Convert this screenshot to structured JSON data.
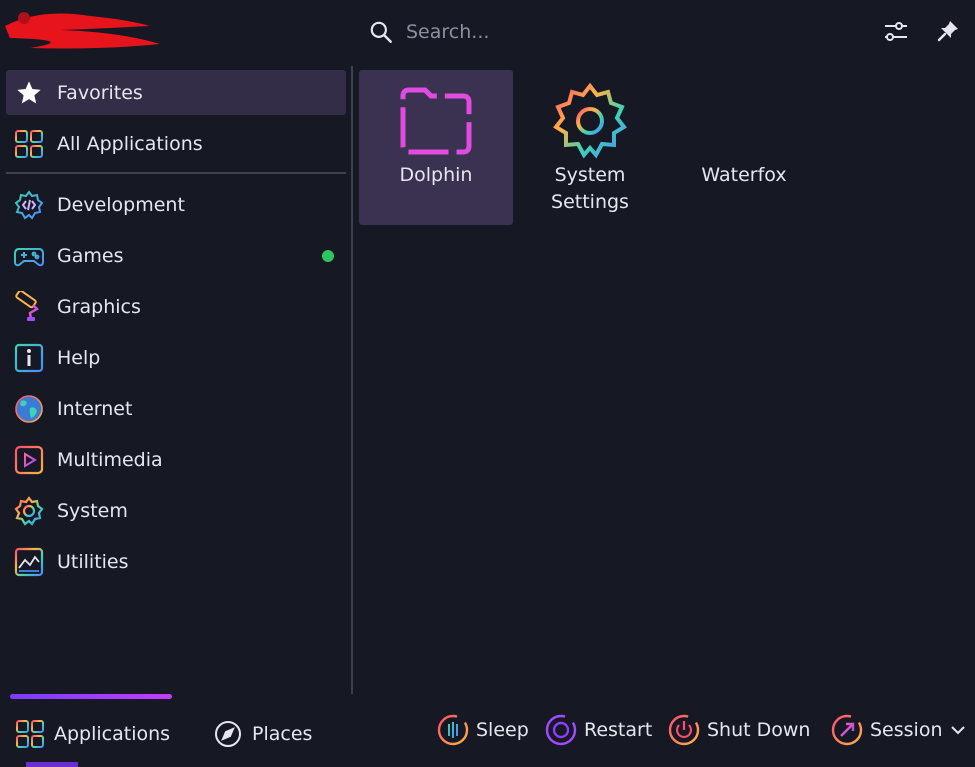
{
  "header": {
    "search_placeholder": "Search...",
    "icons": [
      "search-icon",
      "filter-settings-icon",
      "pin-icon"
    ]
  },
  "sidebar": {
    "items": [
      {
        "label": "Favorites",
        "icon": "star-icon",
        "active": true
      },
      {
        "label": "All Applications",
        "icon": "grid-icon"
      },
      {
        "label": "Development",
        "icon": "development-gear-icon"
      },
      {
        "label": "Games",
        "icon": "gamepad-icon",
        "badge": true
      },
      {
        "label": "Graphics",
        "icon": "paint-roller-icon"
      },
      {
        "label": "Help",
        "icon": "help-info-icon"
      },
      {
        "label": "Internet",
        "icon": "globe-icon"
      },
      {
        "label": "Multimedia",
        "icon": "play-icon"
      },
      {
        "label": "System",
        "icon": "system-gear-icon"
      },
      {
        "label": "Utilities",
        "icon": "utilities-chart-icon"
      }
    ]
  },
  "apps": [
    {
      "label": "Dolphin",
      "icon": "folder-icon",
      "selected": true
    },
    {
      "label": "System\nSettings",
      "icon": "settings-gear-icon"
    },
    {
      "label": "Waterfox",
      "icon": ""
    }
  ],
  "footer": {
    "tabs": [
      {
        "label": "Applications",
        "icon": "applications-grid-icon",
        "active": true
      },
      {
        "label": "Places",
        "icon": "compass-icon"
      }
    ],
    "power": [
      {
        "label": "Sleep",
        "icon": "sleep-icon"
      },
      {
        "label": "Restart",
        "icon": "restart-icon"
      },
      {
        "label": "Shut Down",
        "icon": "shutdown-icon"
      },
      {
        "label": "Session",
        "icon": "session-icon"
      }
    ]
  },
  "colors": {
    "background": "#161824",
    "selection": "#342d47",
    "accent_purple": "#8e3cff",
    "badge_green": "#2cc65e"
  }
}
